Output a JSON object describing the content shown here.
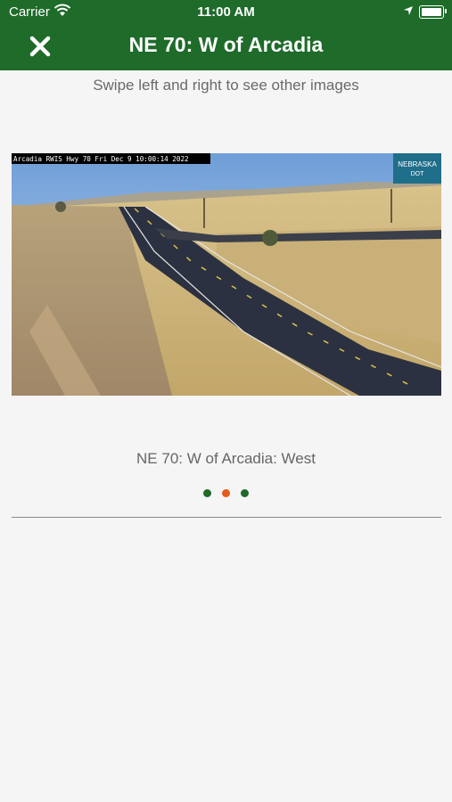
{
  "statusbar": {
    "carrier": "Carrier",
    "time": "11:00 AM"
  },
  "header": {
    "title": "NE 70: W of Arcadia",
    "close_icon": "close-icon"
  },
  "hint": "Swipe left and right to see other images",
  "camera": {
    "overlay_text": "Arcadia RWIS Hwy 70 Fri Dec  9 10:00:14 2022",
    "logo_line1": "NEBRASKA",
    "logo_line2": "DOT",
    "caption": "NE 70: W of Arcadia: West"
  },
  "pager": {
    "count": 3,
    "active_index": 1
  },
  "colors": {
    "header": "#1e6b2a",
    "dot": "#1e6b2a",
    "dot_active": "#e45b1c"
  }
}
